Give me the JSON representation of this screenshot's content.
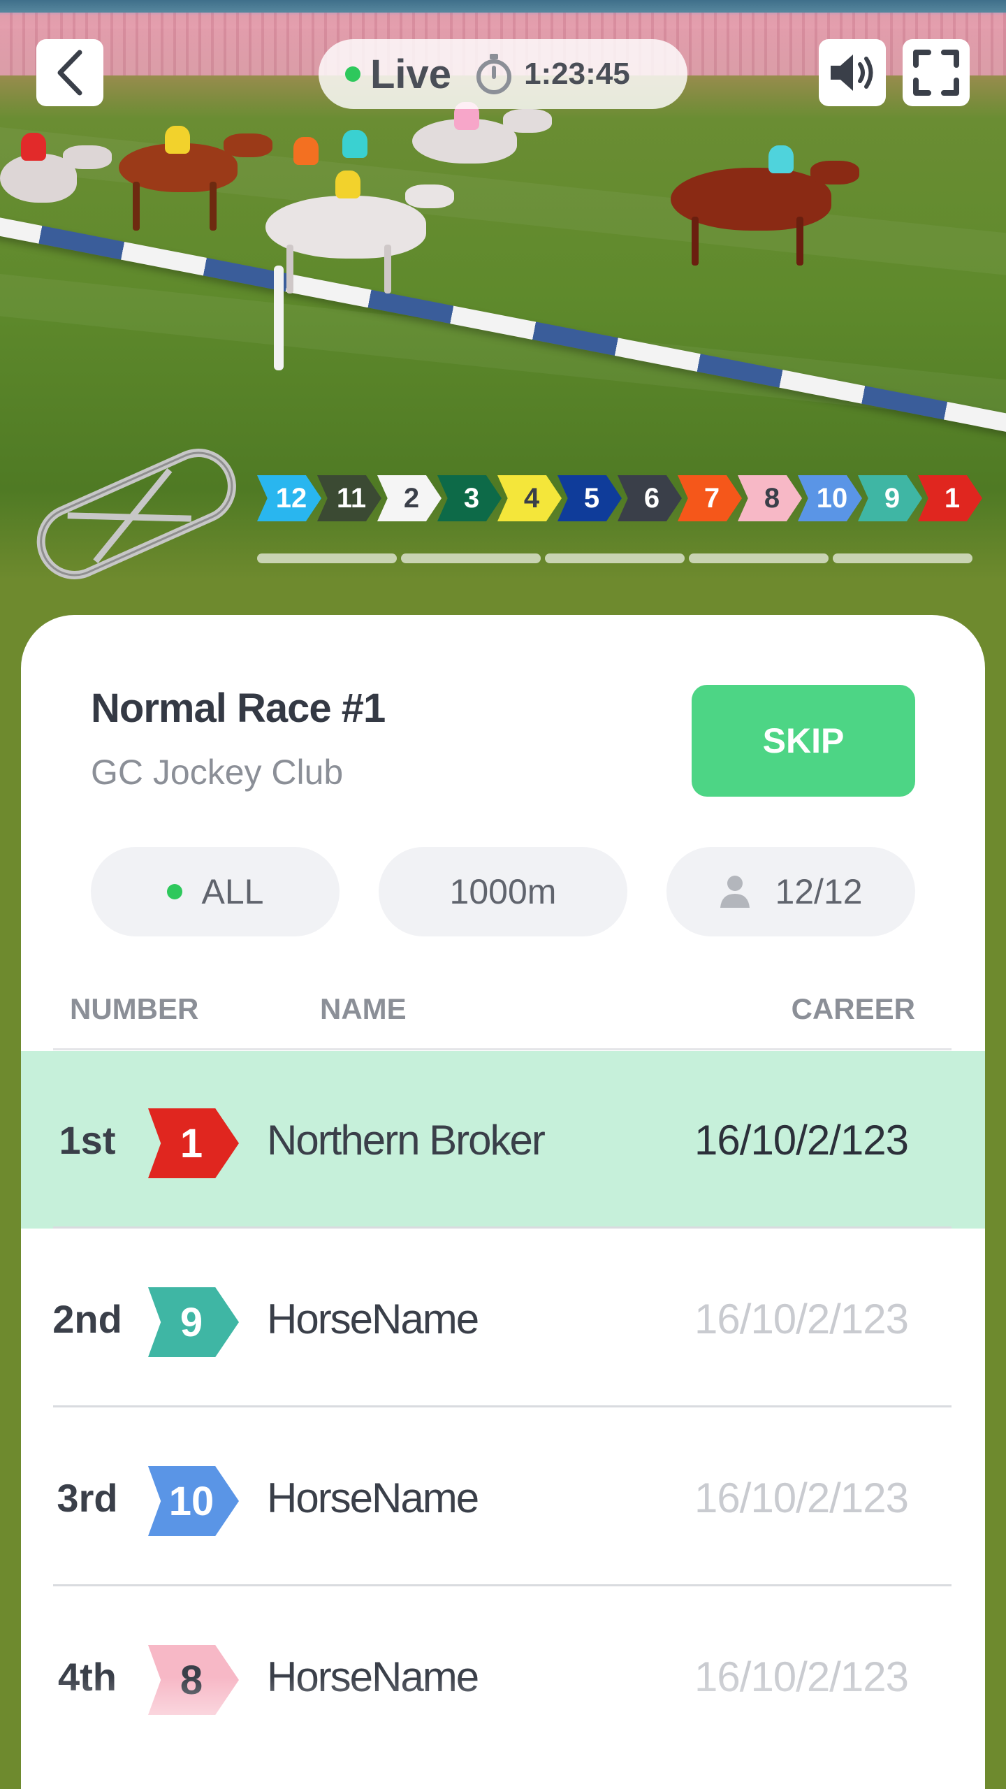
{
  "header": {
    "live_label": "Live",
    "timer": "1:23:45",
    "icons": [
      "back-arrow-icon",
      "stopwatch-icon",
      "speaker-icon",
      "fullscreen-icon"
    ]
  },
  "race_order": [
    {
      "number": "12",
      "color": "#29b6ef"
    },
    {
      "number": "11",
      "color": "#3b4a33"
    },
    {
      "number": "2",
      "color": "#f5f5f5"
    },
    {
      "number": "3",
      "color": "#0d6a48"
    },
    {
      "number": "4",
      "color": "#f4e63a"
    },
    {
      "number": "5",
      "color": "#0f3c9a"
    },
    {
      "number": "6",
      "color": "#3a3f49"
    },
    {
      "number": "7",
      "color": "#f5571a"
    },
    {
      "number": "8",
      "color": "#f7b8c6"
    },
    {
      "number": "10",
      "color": "#5a95e6"
    },
    {
      "number": "9",
      "color": "#3fb6a4"
    },
    {
      "number": "1",
      "color": "#e0261f"
    }
  ],
  "race": {
    "title": "Normal Race #1",
    "club": "GC Jockey Club",
    "skip_label": "SKIP",
    "filter_all": "ALL",
    "distance": "1000m",
    "runners": "12/12"
  },
  "table": {
    "columns": [
      "NUMBER",
      "NAME",
      "CAREER"
    ],
    "rows": [
      {
        "place": "1st",
        "number": "1",
        "color": "#e0261f",
        "name": "Northern Broker",
        "career": "16/10/2/123"
      },
      {
        "place": "2nd",
        "number": "9",
        "color": "#3fb6a4",
        "name": "HorseName",
        "career": "16/10/2/123"
      },
      {
        "place": "3rd",
        "number": "10",
        "color": "#5a95e6",
        "name": "HorseName",
        "career": "16/10/2/123"
      },
      {
        "place": "4th",
        "number": "8",
        "color": "#f7b8c6",
        "name": "HorseName",
        "career": "16/10/2/123"
      }
    ]
  }
}
